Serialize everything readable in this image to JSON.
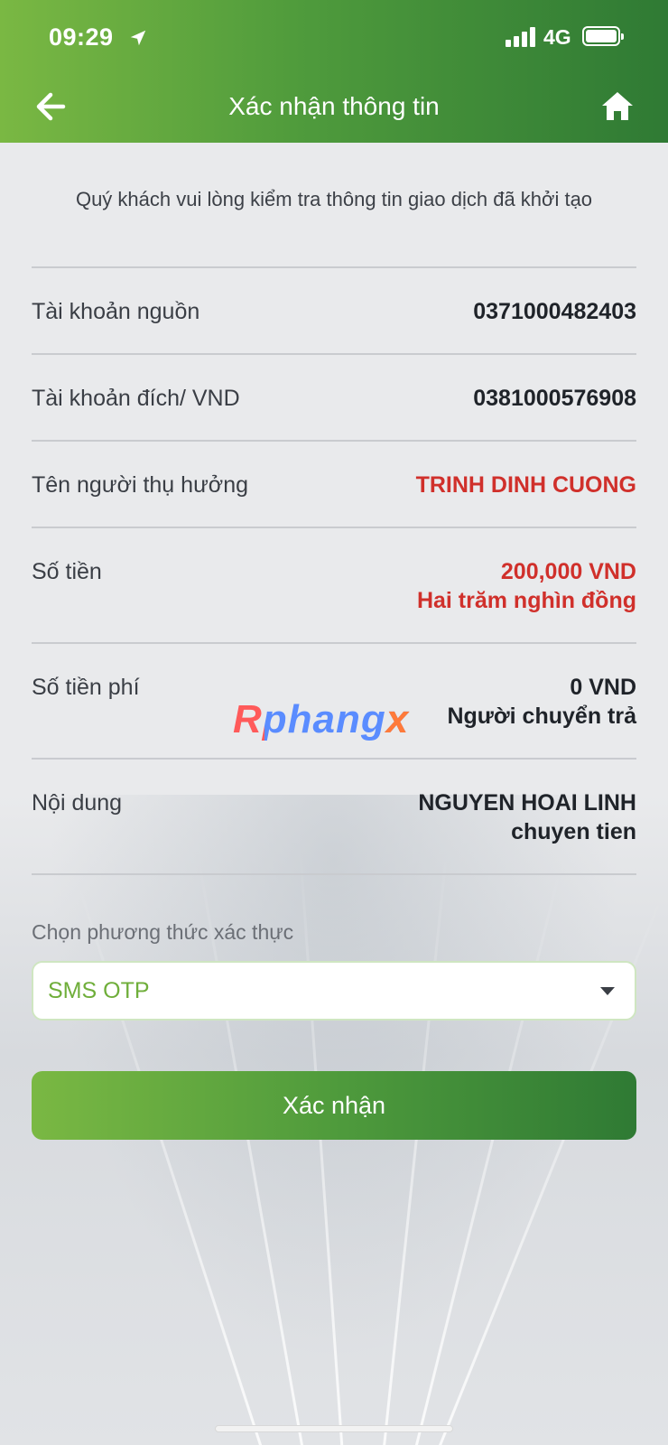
{
  "status_bar": {
    "time": "09:29",
    "network": "4G"
  },
  "header": {
    "title": "Xác nhận thông tin"
  },
  "intro_text": "Quý khách vui lòng kiểm tra thông tin giao dịch đã khởi tạo",
  "rows": [
    {
      "label": "Tài khoản nguồn",
      "value": "0371000482403"
    },
    {
      "label": "Tài khoản đích/ VND",
      "value": "0381000576908"
    },
    {
      "label": "Tên người thụ hưởng",
      "value": "TRINH DINH CUONG"
    },
    {
      "label": "Số tiền",
      "value": "200,000 VND",
      "value2": "Hai trăm nghìn đồng"
    },
    {
      "label": "Số tiền phí",
      "value": "0 VND",
      "value2": "Người chuyển trả"
    },
    {
      "label": "Nội dung",
      "value": "NGUYEN HOAI LINH",
      "value2": "chuyen tien"
    }
  ],
  "auth": {
    "label": "Chọn phương thức xác thực",
    "selected": "SMS OTP"
  },
  "confirm_button": "Xác nhận",
  "watermark": {
    "text_main": "Rphang",
    "text_x": "x"
  },
  "colors": {
    "brand_green": "#4f9b3c",
    "highlight_red": "#d0302b",
    "select_text": "#6fae3a"
  }
}
